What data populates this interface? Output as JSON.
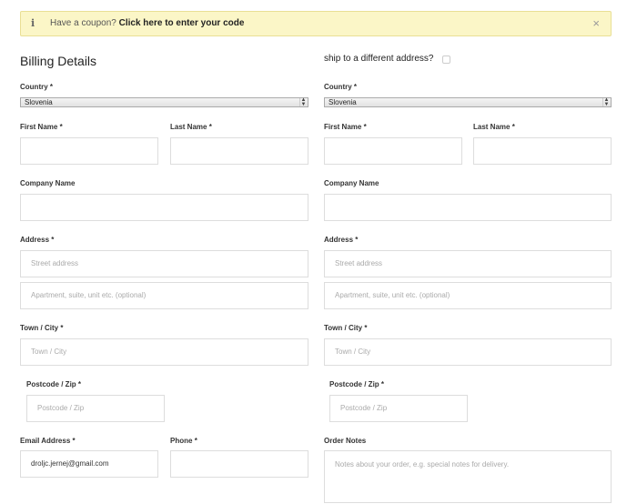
{
  "notice": {
    "icon": "info-icon",
    "text": "Have a coupon?",
    "link": "Click here to enter your code",
    "close": "×"
  },
  "billing": {
    "title": "Billing Details",
    "country_label": "Country",
    "country_value": "Slovenia",
    "first_name_label": "First Name",
    "last_name_label": "Last Name",
    "company_label": "Company Name",
    "address_label": "Address",
    "street_placeholder": "Street address",
    "apartment_placeholder": "Apartment, suite, unit etc. (optional)",
    "town_label": "Town / City",
    "town_placeholder": "Town / City",
    "postcode_label": "Postcode / Zip",
    "postcode_placeholder": "Postcode / Zip",
    "email_label": "Email Address",
    "email_value": "droljc.jernej@gmail.com",
    "phone_label": "Phone"
  },
  "shipping": {
    "toggle_label": "ship to a different address?",
    "country_label": "Country",
    "country_value": "Slovenia",
    "first_name_label": "First Name",
    "last_name_label": "Last Name",
    "company_label": "Company Name",
    "address_label": "Address",
    "street_placeholder": "Street address",
    "apartment_placeholder": "Apartment, suite, unit etc. (optional)",
    "town_label": "Town / City",
    "town_placeholder": "Town / City",
    "postcode_label": "Postcode / Zip",
    "postcode_placeholder": "Postcode / Zip",
    "notes_label": "Order Notes",
    "notes_placeholder": "Notes about your order, e.g. special notes for delivery."
  },
  "required_mark": "*"
}
